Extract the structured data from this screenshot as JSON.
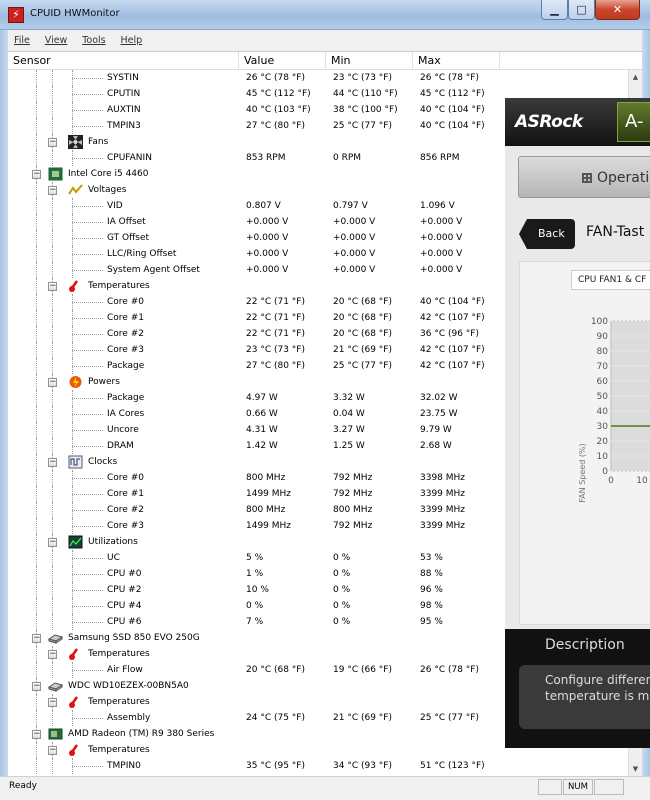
{
  "window": {
    "title": "CPUID HWMonitor",
    "controls": {
      "minimize": "▁",
      "maximize": "□",
      "close": "✕"
    }
  },
  "menu": [
    {
      "label": "File",
      "key": "F"
    },
    {
      "label": "View",
      "key": "V"
    },
    {
      "label": "Tools",
      "key": "T"
    },
    {
      "label": "Help",
      "key": "H"
    }
  ],
  "columns": {
    "sensor": "Sensor",
    "value": "Value",
    "min": "Min",
    "max": "Max"
  },
  "rows": [
    {
      "level": 3,
      "label": "SYSTIN",
      "value": "26 °C  (78 °F)",
      "min": "23 °C  (73 °F)",
      "max": "26 °C  (78 °F)"
    },
    {
      "level": 3,
      "label": "CPUTIN",
      "value": "45 °C  (112 °F)",
      "min": "44 °C  (110 °F)",
      "max": "45 °C  (112 °F)"
    },
    {
      "level": 3,
      "label": "AUXTIN",
      "value": "40 °C  (103 °F)",
      "min": "38 °C  (100 °F)",
      "max": "40 °C  (104 °F)"
    },
    {
      "level": 3,
      "label": "TMPIN3",
      "value": "27 °C  (80 °F)",
      "min": "25 °C  (77 °F)",
      "max": "40 °C  (104 °F)"
    },
    {
      "level": 2,
      "label": "Fans",
      "icon": "fan-icon"
    },
    {
      "level": 3,
      "label": "CPUFANIN",
      "value": "853 RPM",
      "min": "0 RPM",
      "max": "856 RPM"
    },
    {
      "level": 1,
      "label": "Intel Core i5 4460",
      "icon": "cpu-chip-icon"
    },
    {
      "level": 2,
      "label": "Voltages",
      "icon": "voltage-icon"
    },
    {
      "level": 3,
      "label": "VID",
      "value": "0.807 V",
      "min": "0.797 V",
      "max": "1.096 V"
    },
    {
      "level": 3,
      "label": "IA Offset",
      "value": "+0.000 V",
      "min": "+0.000 V",
      "max": "+0.000 V"
    },
    {
      "level": 3,
      "label": "GT Offset",
      "value": "+0.000 V",
      "min": "+0.000 V",
      "max": "+0.000 V"
    },
    {
      "level": 3,
      "label": "LLC/Ring Offset",
      "value": "+0.000 V",
      "min": "+0.000 V",
      "max": "+0.000 V"
    },
    {
      "level": 3,
      "label": "System Agent Offset",
      "value": "+0.000 V",
      "min": "+0.000 V",
      "max": "+0.000 V"
    },
    {
      "level": 2,
      "label": "Temperatures",
      "icon": "thermometer-icon"
    },
    {
      "level": 3,
      "label": "Core #0",
      "value": "22 °C  (71 °F)",
      "min": "20 °C  (68 °F)",
      "max": "40 °C  (104 °F)"
    },
    {
      "level": 3,
      "label": "Core #1",
      "value": "22 °C  (71 °F)",
      "min": "20 °C  (68 °F)",
      "max": "42 °C  (107 °F)"
    },
    {
      "level": 3,
      "label": "Core #2",
      "value": "22 °C  (71 °F)",
      "min": "20 °C  (68 °F)",
      "max": "36 °C  (96 °F)"
    },
    {
      "level": 3,
      "label": "Core #3",
      "value": "23 °C  (73 °F)",
      "min": "21 °C  (69 °F)",
      "max": "42 °C  (107 °F)"
    },
    {
      "level": 3,
      "label": "Package",
      "value": "27 °C  (80 °F)",
      "min": "25 °C  (77 °F)",
      "max": "42 °C  (107 °F)"
    },
    {
      "level": 2,
      "label": "Powers",
      "icon": "power-icon"
    },
    {
      "level": 3,
      "label": "Package",
      "value": "4.97 W",
      "min": "3.32 W",
      "max": "32.02 W"
    },
    {
      "level": 3,
      "label": "IA Cores",
      "value": "0.66 W",
      "min": "0.04 W",
      "max": "23.75 W"
    },
    {
      "level": 3,
      "label": "Uncore",
      "value": "4.31 W",
      "min": "3.27 W",
      "max": "9.79 W"
    },
    {
      "level": 3,
      "label": "DRAM",
      "value": "1.42 W",
      "min": "1.25 W",
      "max": "2.68 W"
    },
    {
      "level": 2,
      "label": "Clocks",
      "icon": "clock-wave-icon"
    },
    {
      "level": 3,
      "label": "Core #0",
      "value": "800 MHz",
      "min": "792 MHz",
      "max": "3398 MHz"
    },
    {
      "level": 3,
      "label": "Core #1",
      "value": "1499 MHz",
      "min": "792 MHz",
      "max": "3399 MHz"
    },
    {
      "level": 3,
      "label": "Core #2",
      "value": "800 MHz",
      "min": "800 MHz",
      "max": "3399 MHz"
    },
    {
      "level": 3,
      "label": "Core #3",
      "value": "1499 MHz",
      "min": "792 MHz",
      "max": "3399 MHz"
    },
    {
      "level": 2,
      "label": "Utilizations",
      "icon": "utilization-graph-icon"
    },
    {
      "level": 3,
      "label": "UC",
      "value": "5 %",
      "min": "0 %",
      "max": "53 %"
    },
    {
      "level": 3,
      "label": "CPU #0",
      "value": "1 %",
      "min": "0 %",
      "max": "88 %"
    },
    {
      "level": 3,
      "label": "CPU #2",
      "value": "10 %",
      "min": "0 %",
      "max": "96 %"
    },
    {
      "level": 3,
      "label": "CPU #4",
      "value": "0 %",
      "min": "0 %",
      "max": "98 %"
    },
    {
      "level": 3,
      "label": "CPU #6",
      "value": "7 %",
      "min": "0 %",
      "max": "95 %"
    },
    {
      "level": 1,
      "label": "Samsung SSD 850 EVO 250G",
      "icon": "drive-icon"
    },
    {
      "level": 2,
      "label": "Temperatures",
      "icon": "thermometer-icon"
    },
    {
      "level": 3,
      "label": "Air Flow",
      "value": "20 °C  (68 °F)",
      "min": "19 °C  (66 °F)",
      "max": "26 °C  (78 °F)"
    },
    {
      "level": 1,
      "label": "WDC WD10EZEX-00BN5A0",
      "icon": "drive-icon"
    },
    {
      "level": 2,
      "label": "Temperatures",
      "icon": "thermometer-icon"
    },
    {
      "level": 3,
      "label": "Assembly",
      "value": "24 °C  (75 °F)",
      "min": "21 °C  (69 °F)",
      "max": "25 °C  (77 °F)"
    },
    {
      "level": 1,
      "label": "AMD Radeon (TM) R9 380 Series",
      "icon": "gpu-card-icon"
    },
    {
      "level": 2,
      "label": "Temperatures",
      "icon": "thermometer-icon"
    },
    {
      "level": 3,
      "label": "TMPIN0",
      "value": "35 °C  (95 °F)",
      "min": "34 °C  (93 °F)",
      "max": "51 °C  (123 °F)"
    }
  ],
  "status": {
    "text": "Ready",
    "num": "NUM"
  },
  "overlay": {
    "brand": "ASRock",
    "top_tab": "A-",
    "operation_button": "Operatio",
    "back": "Back",
    "title": "FAN-Tast",
    "fan_select": "CPU FAN1 & CF",
    "chart_ylabel": "FAN Speed (%)",
    "description_title": "Description",
    "description_lines": [
      "Configure differen",
      "temperature is me"
    ],
    "colors": {
      "header": "#1a1a1a",
      "accent": "#6b8a2a",
      "curve": "#4a7a1a"
    }
  },
  "chart_data": {
    "type": "line",
    "ylabel": "FAN Speed (%)",
    "yticks": [
      0,
      10,
      20,
      30,
      40,
      50,
      60,
      70,
      80,
      90,
      100
    ],
    "xticks": [
      0,
      10
    ],
    "ylim": [
      0,
      100
    ],
    "series": [
      {
        "x": [
          0,
          10
        ],
        "values": [
          30,
          30
        ]
      }
    ],
    "grid": true
  }
}
